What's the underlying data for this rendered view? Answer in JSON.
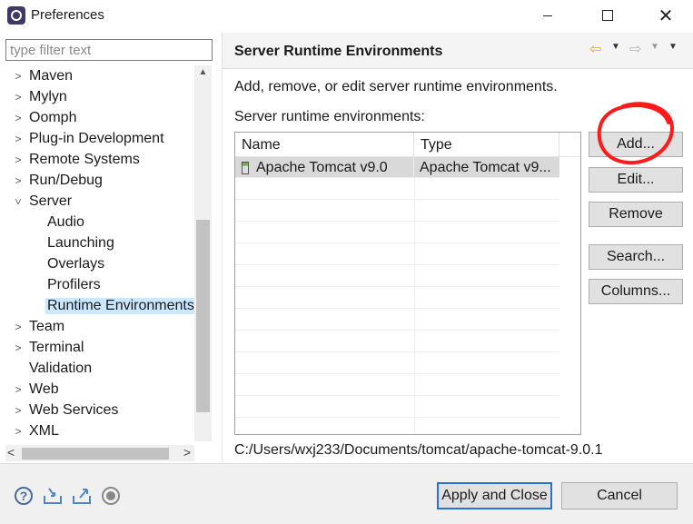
{
  "window": {
    "title": "Preferences",
    "minimize_glyph": "",
    "maximize_glyph": "",
    "close_glyph": "✕"
  },
  "filter": {
    "placeholder": "type filter text",
    "value": ""
  },
  "tree": {
    "items": [
      {
        "label": "Maven",
        "expanded": false,
        "level": 0
      },
      {
        "label": "Mylyn",
        "expanded": false,
        "level": 0
      },
      {
        "label": "Oomph",
        "expanded": false,
        "level": 0
      },
      {
        "label": "Plug-in Development",
        "expanded": false,
        "level": 0
      },
      {
        "label": "Remote Systems",
        "expanded": false,
        "level": 0
      },
      {
        "label": "Run/Debug",
        "expanded": false,
        "level": 0
      },
      {
        "label": "Server",
        "expanded": true,
        "level": 0
      },
      {
        "label": "Audio",
        "level": 1
      },
      {
        "label": "Launching",
        "level": 1
      },
      {
        "label": "Overlays",
        "level": 1
      },
      {
        "label": "Profilers",
        "level": 1
      },
      {
        "label": "Runtime Environments",
        "level": 1,
        "selected": true
      },
      {
        "label": "Team",
        "expanded": false,
        "level": 0
      },
      {
        "label": "Terminal",
        "expanded": false,
        "level": 0
      },
      {
        "label": "Validation",
        "level": 0,
        "leaf": true
      },
      {
        "label": "Web",
        "expanded": false,
        "level": 0
      },
      {
        "label": "Web Services",
        "expanded": false,
        "level": 0
      },
      {
        "label": "XML",
        "expanded": false,
        "level": 0
      }
    ]
  },
  "page": {
    "title": "Server Runtime Environments",
    "description": "Add, remove, or edit server runtime environments.",
    "table_label": "Server runtime environments:",
    "path": "C:/Users/wxj233/Documents/tomcat/apache-tomcat-9.0.1"
  },
  "table": {
    "columns": [
      "Name",
      "Type"
    ],
    "rows": [
      {
        "name": "Apache Tomcat v9.0",
        "type": "Apache Tomcat v9...",
        "selected": true
      }
    ]
  },
  "buttons": {
    "add": "Add...",
    "edit": "Edit...",
    "remove": "Remove",
    "search": "Search...",
    "columns": "Columns...",
    "apply_close": "Apply and Close",
    "cancel": "Cancel"
  },
  "icons": {
    "help": "help-icon",
    "import": "import-icon",
    "export": "export-icon",
    "record": "record-icon",
    "back": "back-arrow-icon",
    "forward": "forward-arrow-icon"
  },
  "colors": {
    "selection": "#cce8ff",
    "annotation": "#ff1a1a",
    "default_button_border": "#2a70d1"
  }
}
